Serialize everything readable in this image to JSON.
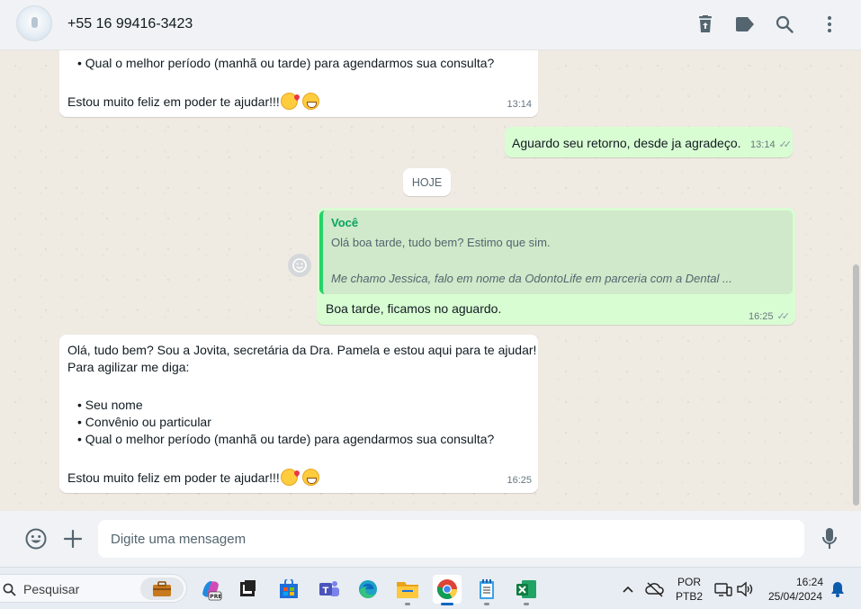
{
  "header": {
    "contact": "+55 16 99416-3423"
  },
  "messages": {
    "first": {
      "lines": [
        "• Qual o melhor período (manhã ou tarde) para agendarmos sua consulta?",
        "Estou muito feliz em poder te ajudar!!!"
      ],
      "time": "13:14"
    },
    "second": {
      "text": "Aguardo seu retorno, desde ja agradeço.",
      "time": "13:14"
    },
    "date_chip": "HOJE",
    "reply": {
      "quote_author": "Você",
      "quote_line1": "Olá boa tarde, tudo bem? Estimo que sim.",
      "quote_line2": "Me chamo Jessica, falo em nome da OdontoLife em parceria com a Dental ...",
      "text": "Boa tarde, ficamos no aguardo.",
      "time": "16:25"
    },
    "last": {
      "lines": [
        "Olá, tudo bem? Sou a Jovita, secretária da Dra. Pamela e estou aqui para te ajudar!",
        "Para agilizar me diga:",
        "• Seu nome",
        "• Convênio ou particular",
        "• Qual o melhor período (manhã ou tarde) para agendarmos sua consulta?",
        "Estou muito feliz em poder te ajudar!!!"
      ],
      "time": "16:25"
    }
  },
  "compose": {
    "placeholder": "Digite uma mensagem"
  },
  "taskbar": {
    "search_label": "Pesquisar",
    "lang_top": "POR",
    "lang_bottom": "PTB2",
    "clock_time": "16:24",
    "clock_date": "25/04/2024",
    "apps": [
      "briefcase-icon",
      "copilot-icon",
      "task-view-icon",
      "store-icon",
      "teams-icon",
      "edge-icon",
      "file-explorer-icon",
      "chrome-icon",
      "notepad-icon",
      "excel-icon"
    ]
  },
  "colors": {
    "incoming_bubble": "#ffffff",
    "outgoing_bubble": "#d9fdd3",
    "accent_green": "#25d366",
    "chat_background": "#efeae2"
  }
}
